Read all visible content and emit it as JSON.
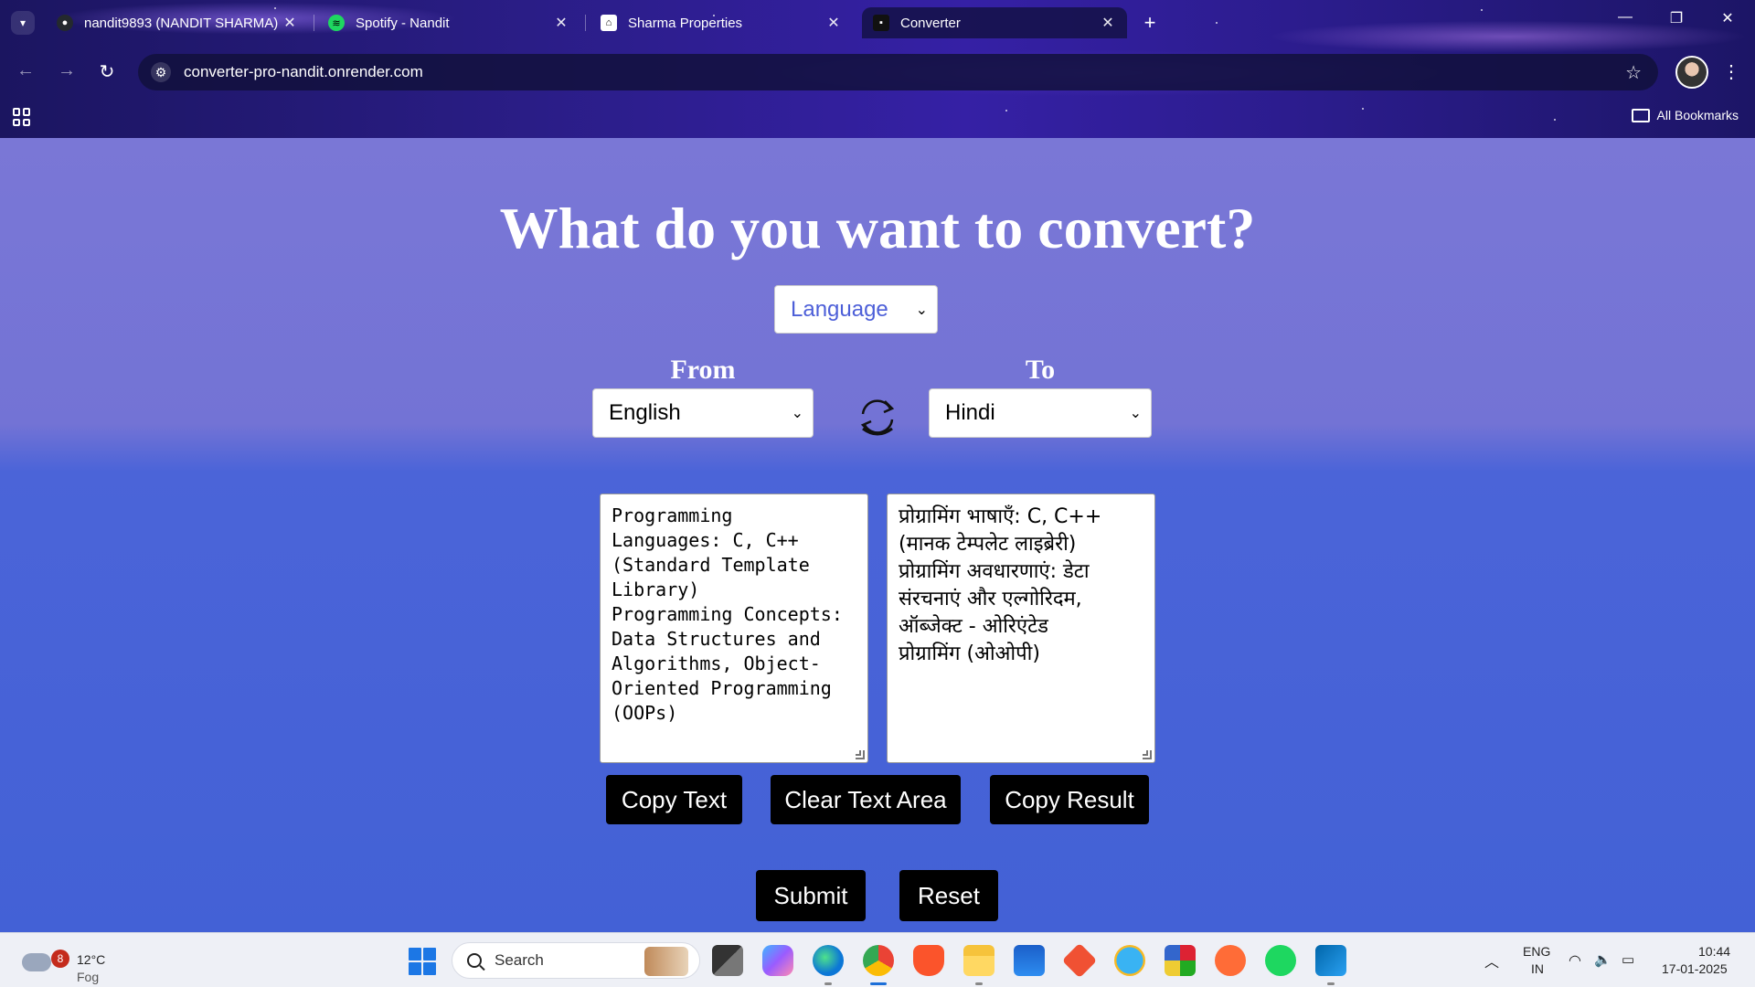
{
  "browser": {
    "tabs": [
      {
        "title": "nandit9893 (NANDIT SHARMA)",
        "icon": "github-icon",
        "active": false
      },
      {
        "title": "Spotify - Nandit",
        "icon": "spotify-icon",
        "active": false
      },
      {
        "title": "Sharma Properties",
        "icon": "sharma-properties-icon",
        "active": false
      },
      {
        "title": "Converter",
        "icon": "converter-favicon",
        "active": true
      }
    ],
    "url": "converter-pro-nandit.onrender.com",
    "bookmarks_label": "All Bookmarks"
  },
  "page": {
    "title": "What do you want to convert?",
    "mode_select": {
      "selected": "Language"
    },
    "from_label": "From",
    "to_label": "To",
    "from_select": {
      "selected": "English"
    },
    "to_select": {
      "selected": "Hindi"
    },
    "source_text": "Programming\nLanguages: C, C++\n(Standard Template\nLibrary)\nProgramming Concepts:\nData Structures and\nAlgorithms, Object-\nOriented Programming\n(OOPs)",
    "result_text": "प्रोग्रामिंग भाषाएँ: C, C++\n(मानक टेम्पलेट लाइब्रेरी)\nप्रोग्रामिंग अवधारणाएं: डेटा\nसंरचनाएं और एल्गोरिदम,\nऑब्जेक्ट - ओरिएंटेड\nप्रोग्रामिंग (ओओपी)",
    "buttons": {
      "copy_text": "Copy Text",
      "clear": "Clear Text Area",
      "copy_result": "Copy Result",
      "submit": "Submit",
      "reset": "Reset"
    },
    "colors": {
      "select_accent": "#4d5fd8",
      "button_bg": "#000000"
    }
  },
  "taskbar": {
    "weather": {
      "temp": "12°C",
      "condition": "Fog",
      "badge": "8"
    },
    "search_placeholder": "Search",
    "apps": [
      "task-view-icon",
      "copilot-icon",
      "edge-icon",
      "chrome-icon",
      "brave-icon",
      "file-explorer-icon",
      "store-icon",
      "git-icon",
      "telegram-icon",
      "winrar-icon",
      "postman-icon",
      "spotify-icon",
      "vscode-icon"
    ],
    "lang_line1": "ENG",
    "lang_line2": "IN",
    "time": "10:44",
    "date": "17-01-2025"
  }
}
